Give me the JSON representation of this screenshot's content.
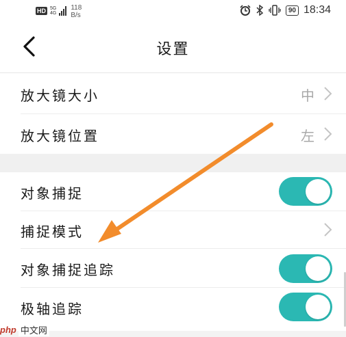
{
  "status_bar": {
    "hd": "HD",
    "network": "5G",
    "network_sub": "4G",
    "speed_value": "118",
    "speed_unit": "B/s",
    "battery": "90",
    "time": "18:34"
  },
  "header": {
    "title": "设置"
  },
  "rows": [
    {
      "label": "放大镜大小",
      "value": "中"
    },
    {
      "label": "放大镜位置",
      "value": "左"
    },
    {
      "label": "对象捕捉",
      "toggle": true
    },
    {
      "label": "捕捉模式"
    },
    {
      "label": "对象捕捉追踪",
      "toggle": true
    },
    {
      "label": "极轴追踪",
      "toggle": true
    }
  ],
  "colors": {
    "toggle_on": "#2bb8b3",
    "arrow": "#f28c2c",
    "section_gap": "#f0f0f0"
  },
  "watermark": {
    "logo": "php",
    "text": "中文网"
  },
  "icons": {
    "back": "chevron-left-icon",
    "row_arrow": "chevron-right-icon",
    "alarm": "alarm-icon",
    "bluetooth": "bluetooth-icon",
    "vibrate": "vibrate-icon"
  }
}
